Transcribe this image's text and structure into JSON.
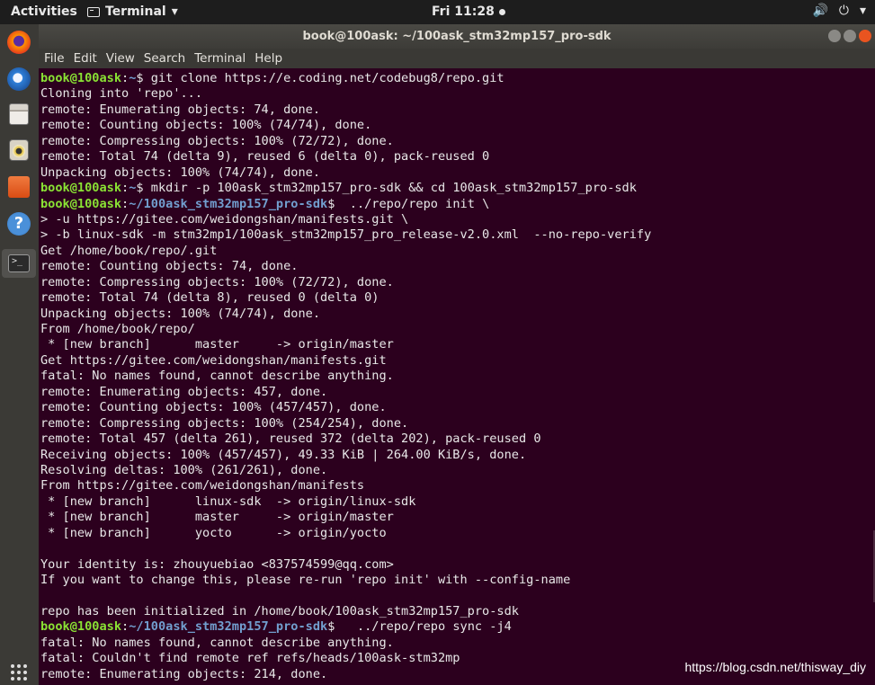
{
  "topbar": {
    "activities": "Activities",
    "app_name": "Terminal",
    "app_arrow": "▾",
    "clock": "Fri 11:28",
    "tray": [
      "🔊",
      "⏻",
      "▾"
    ]
  },
  "dock": {
    "icons": [
      "firefox-icon",
      "thunderbird-icon",
      "files-icon",
      "rhythmbox-icon",
      "software-center-icon",
      "help-icon",
      "terminal-icon",
      "show-apps-icon"
    ]
  },
  "window": {
    "title": "book@100ask: ~/100ask_stm32mp157_pro-sdk"
  },
  "menubar": {
    "items": [
      "File",
      "Edit",
      "View",
      "Search",
      "Terminal",
      "Help"
    ]
  },
  "terminal": {
    "lines": [
      {
        "user": "book@100ask",
        "sep": ":",
        "path": "~",
        "cmd": "$ git clone https://e.coding.net/codebug8/repo.git"
      },
      {
        "text": "Cloning into 'repo'..."
      },
      {
        "text": "remote: Enumerating objects: 74, done."
      },
      {
        "text": "remote: Counting objects: 100% (74/74), done."
      },
      {
        "text": "remote: Compressing objects: 100% (72/72), done."
      },
      {
        "text": "remote: Total 74 (delta 9), reused 6 (delta 0), pack-reused 0"
      },
      {
        "text": "Unpacking objects: 100% (74/74), done."
      },
      {
        "user": "book@100ask",
        "sep": ":",
        "path": "~",
        "cmd": "$ mkdir -p 100ask_stm32mp157_pro-sdk && cd 100ask_stm32mp157_pro-sdk"
      },
      {
        "user": "book@100ask",
        "sep": ":",
        "path": "~/100ask_stm32mp157_pro-sdk",
        "cmd": "$  ../repo/repo init \\"
      },
      {
        "text": "> -u https://gitee.com/weidongshan/manifests.git \\"
      },
      {
        "text": "> -b linux-sdk -m stm32mp1/100ask_stm32mp157_pro_release-v2.0.xml  --no-repo-verify"
      },
      {
        "text": "Get /home/book/repo/.git"
      },
      {
        "text": "remote: Counting objects: 74, done."
      },
      {
        "text": "remote: Compressing objects: 100% (72/72), done."
      },
      {
        "text": "remote: Total 74 (delta 8), reused 0 (delta 0)"
      },
      {
        "text": "Unpacking objects: 100% (74/74), done."
      },
      {
        "text": "From /home/book/repo/"
      },
      {
        "text": " * [new branch]      master     -> origin/master"
      },
      {
        "text": "Get https://gitee.com/weidongshan/manifests.git"
      },
      {
        "text": "fatal: No names found, cannot describe anything."
      },
      {
        "text": "remote: Enumerating objects: 457, done."
      },
      {
        "text": "remote: Counting objects: 100% (457/457), done."
      },
      {
        "text": "remote: Compressing objects: 100% (254/254), done."
      },
      {
        "text": "remote: Total 457 (delta 261), reused 372 (delta 202), pack-reused 0"
      },
      {
        "text": "Receiving objects: 100% (457/457), 49.33 KiB | 264.00 KiB/s, done."
      },
      {
        "text": "Resolving deltas: 100% (261/261), done."
      },
      {
        "text": "From https://gitee.com/weidongshan/manifests"
      },
      {
        "text": " * [new branch]      linux-sdk  -> origin/linux-sdk"
      },
      {
        "text": " * [new branch]      master     -> origin/master"
      },
      {
        "text": " * [new branch]      yocto      -> origin/yocto"
      },
      {
        "text": ""
      },
      {
        "text": "Your identity is: zhouyuebiao <837574599@qq.com>"
      },
      {
        "text": "If you want to change this, please re-run 'repo init' with --config-name"
      },
      {
        "text": ""
      },
      {
        "text": "repo has been initialized in /home/book/100ask_stm32mp157_pro-sdk"
      },
      {
        "user": "book@100ask",
        "sep": ":",
        "path": "~/100ask_stm32mp157_pro-sdk",
        "cmd": "$   ../repo/repo sync -j4"
      },
      {
        "text": "fatal: No names found, cannot describe anything."
      },
      {
        "text": "fatal: Couldn't find remote ref refs/heads/100ask-stm32mp"
      },
      {
        "text": "remote: Enumerating objects: 214, done."
      }
    ]
  },
  "watermark": "https://blog.csdn.net/thisway_diy",
  "colors": {
    "terminal_bg": "#2c001e",
    "prompt_user": "#8ae234",
    "prompt_path": "#729fcf",
    "close_button": "#e95420"
  }
}
